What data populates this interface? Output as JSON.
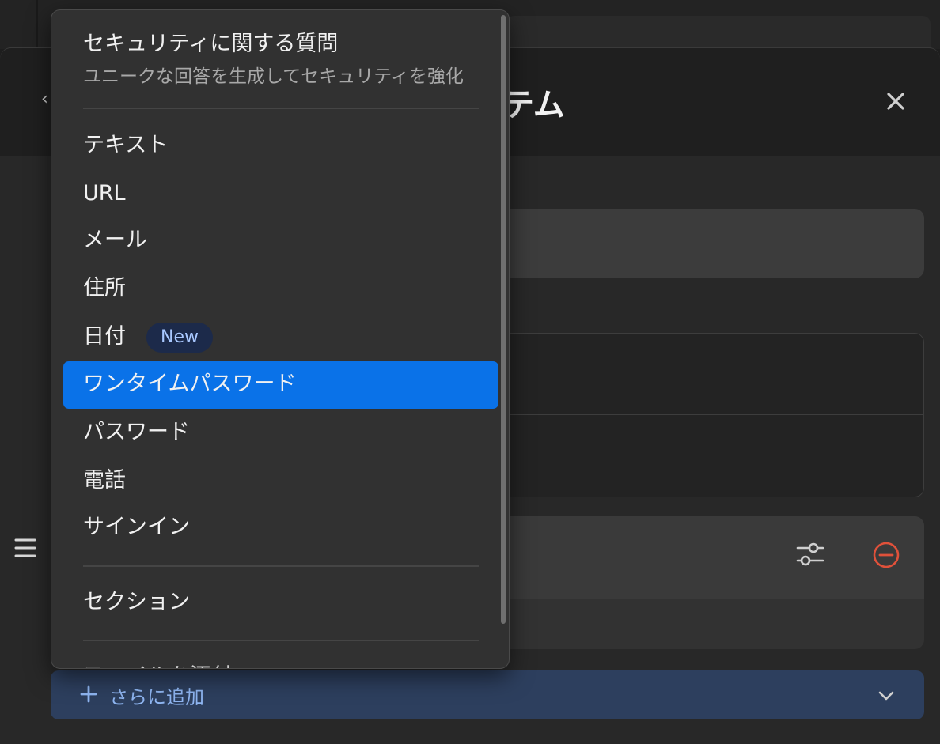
{
  "page": {
    "title": "テム"
  },
  "menu": {
    "security_question": {
      "label": "セキュリティに関する質問",
      "description": "ユニークな回答を生成してセキュリティを強化"
    },
    "items": [
      {
        "label": "テキスト"
      },
      {
        "label": "URL"
      },
      {
        "label": "メール"
      },
      {
        "label": "住所"
      },
      {
        "label": "日付",
        "badge": "New"
      },
      {
        "label": "ワンタイムパスワード",
        "selected": true
      },
      {
        "label": "パスワード"
      },
      {
        "label": "電話"
      },
      {
        "label": "サインイン"
      }
    ],
    "section": {
      "label": "セクション"
    },
    "attach": {
      "label": "ファイルを添付"
    }
  },
  "footer": {
    "add_more_label": "さらに追加"
  },
  "colors": {
    "accent": "#0a72e8",
    "remove": "#e0513a",
    "add_more_bg": "#2d3f5e",
    "add_more_text": "#8fb6f2"
  },
  "icons": {
    "back": "chevron-left-icon",
    "close": "close-icon",
    "drag": "hamburger-icon",
    "options": "sliders-icon",
    "remove": "minus-circle-icon",
    "add": "plus-icon",
    "expand": "chevron-down-icon"
  }
}
